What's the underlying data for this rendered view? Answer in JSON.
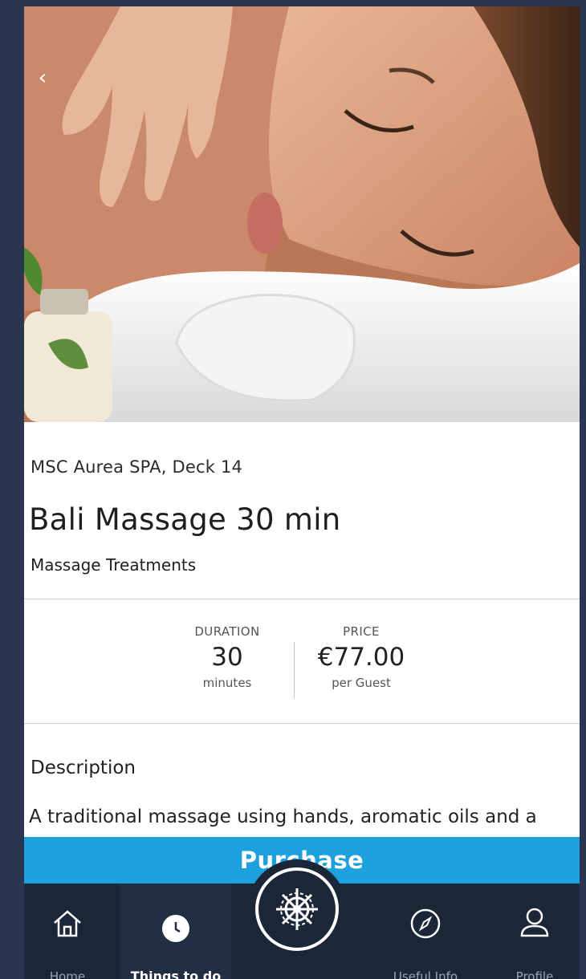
{
  "venue": "MSC Aurea SPA, Deck 14",
  "title": "Bali Massage 30 min",
  "category": "Massage Treatments",
  "stats": {
    "duration": {
      "label": "DURATION",
      "value": "30",
      "unit": "minutes"
    },
    "price": {
      "label": "PRICE",
      "value": "€77.00",
      "unit": "per Guest"
    }
  },
  "description": {
    "heading": "Description",
    "text": "A traditional massage using hands, aromatic oils and a mixture of Balinese techniques to reach"
  },
  "purchase_label": "Purchase",
  "tabbar": {
    "items": [
      {
        "label": "Home",
        "icon": "home-icon"
      },
      {
        "label": "Things to do",
        "icon": "clock-icon",
        "active": true
      },
      {
        "label": "",
        "icon": "ship-wheel-icon"
      },
      {
        "label": "Useful Info",
        "icon": "compass-icon"
      },
      {
        "label": "Profile",
        "icon": "profile-icon"
      }
    ]
  },
  "colors": {
    "accent": "#1da0dc",
    "tabbar_bg": "#1b2638",
    "frame_bg": "#2a3550"
  }
}
